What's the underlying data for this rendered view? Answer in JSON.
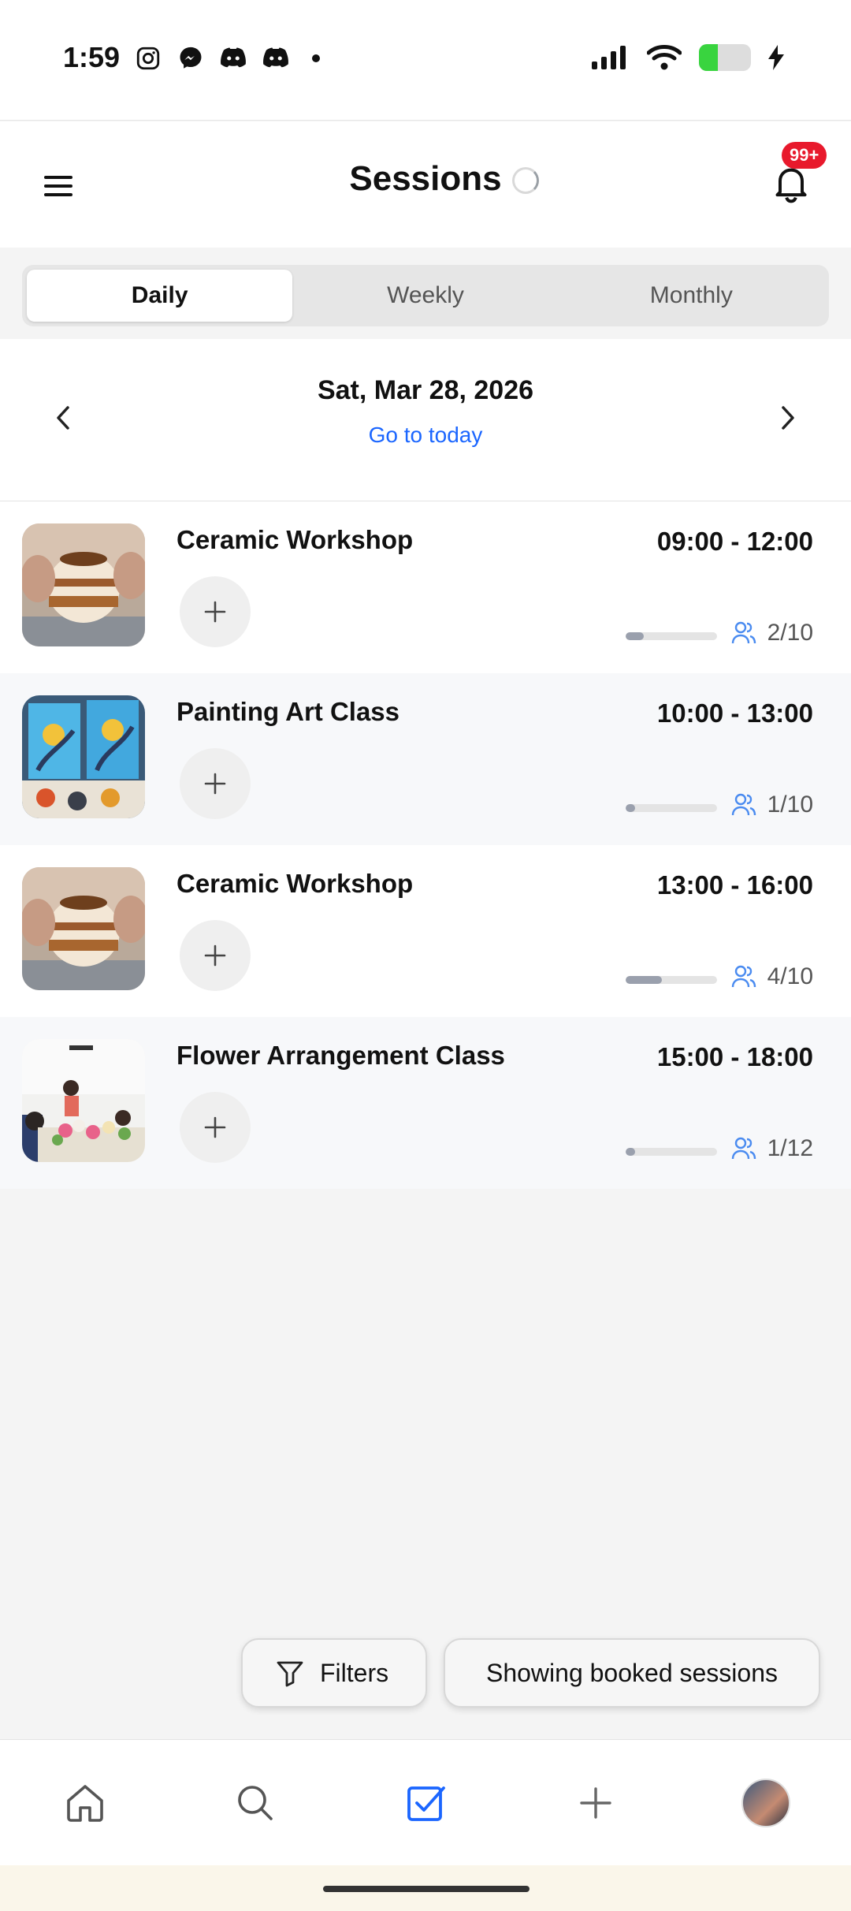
{
  "status": {
    "time": "1:59"
  },
  "header": {
    "title": "Sessions",
    "badge": "99+"
  },
  "tabs": [
    {
      "label": "Daily",
      "active": true
    },
    {
      "label": "Weekly",
      "active": false
    },
    {
      "label": "Monthly",
      "active": false
    }
  ],
  "date": {
    "current": "Sat, Mar 28, 2026",
    "goto_today": "Go to today"
  },
  "sessions": [
    {
      "title": "Ceramic Workshop",
      "time": "09:00 - 12:00",
      "booked": 2,
      "capacity": 10,
      "count_label": "2/10",
      "image": "ceramic-pot-photo"
    },
    {
      "title": "Painting Art Class",
      "time": "10:00 - 13:00",
      "booked": 1,
      "capacity": 10,
      "count_label": "1/10",
      "image": "painting-class-photo"
    },
    {
      "title": "Ceramic Workshop",
      "time": "13:00 - 16:00",
      "booked": 4,
      "capacity": 10,
      "count_label": "4/10",
      "image": "ceramic-pot-photo"
    },
    {
      "title": "Flower Arrangement Class",
      "time": "15:00 - 18:00",
      "booked": 1,
      "capacity": 12,
      "count_label": "1/12",
      "image": "flower-class-photo"
    }
  ],
  "chips": {
    "filters": "Filters",
    "booked": "Showing booked sessions"
  },
  "nav": [
    "home-icon",
    "search-icon",
    "check-square-icon",
    "plus-icon",
    "profile-avatar"
  ],
  "colors": {
    "accent": "#1b66ff",
    "badge": "#e8192c",
    "battery": "#39d43f"
  }
}
